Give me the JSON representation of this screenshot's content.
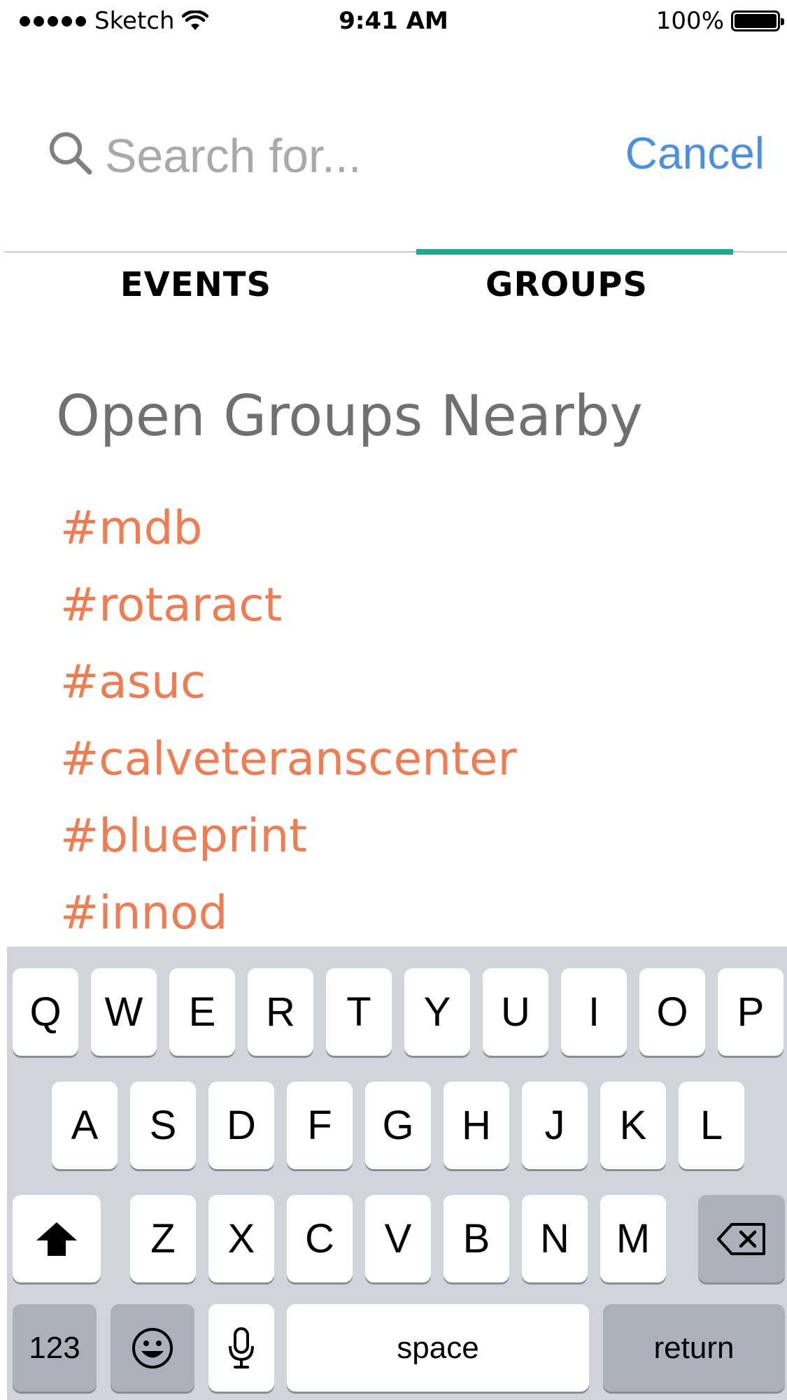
{
  "status_bar": {
    "carrier": "Sketch",
    "time": "9:41 AM",
    "battery": "100%"
  },
  "search": {
    "placeholder": "Search for...",
    "value": "",
    "cancel_label": "Cancel"
  },
  "tabs": [
    {
      "label": "EVENTS",
      "selected": false
    },
    {
      "label": "GROUPS",
      "selected": true
    }
  ],
  "section": {
    "title": "Open Groups Nearby"
  },
  "groups": [
    "#mdb",
    "#rotaract",
    "#asuc",
    "#calveteranscenter",
    "#blueprint",
    "#innod"
  ],
  "keyboard": {
    "row1": [
      "Q",
      "W",
      "E",
      "R",
      "T",
      "Y",
      "U",
      "I",
      "O",
      "P"
    ],
    "row2": [
      "A",
      "S",
      "D",
      "F",
      "G",
      "H",
      "J",
      "K",
      "L"
    ],
    "row3": [
      "Z",
      "X",
      "C",
      "V",
      "B",
      "N",
      "M"
    ],
    "shift_icon": "shift-arrow-icon",
    "delete_icon": "backspace-icon",
    "numbers_label": "123",
    "emoji_icon": "emoji-smile-icon",
    "mic_icon": "microphone-icon",
    "space_label": "space",
    "return_label": "return"
  },
  "colors": {
    "accent_blue": "#4a90e2",
    "tab_indicator": "#1ea896",
    "group_orange": "#f07c52",
    "title_gray": "#707070",
    "keyboard_bg": "#d1d5db"
  }
}
